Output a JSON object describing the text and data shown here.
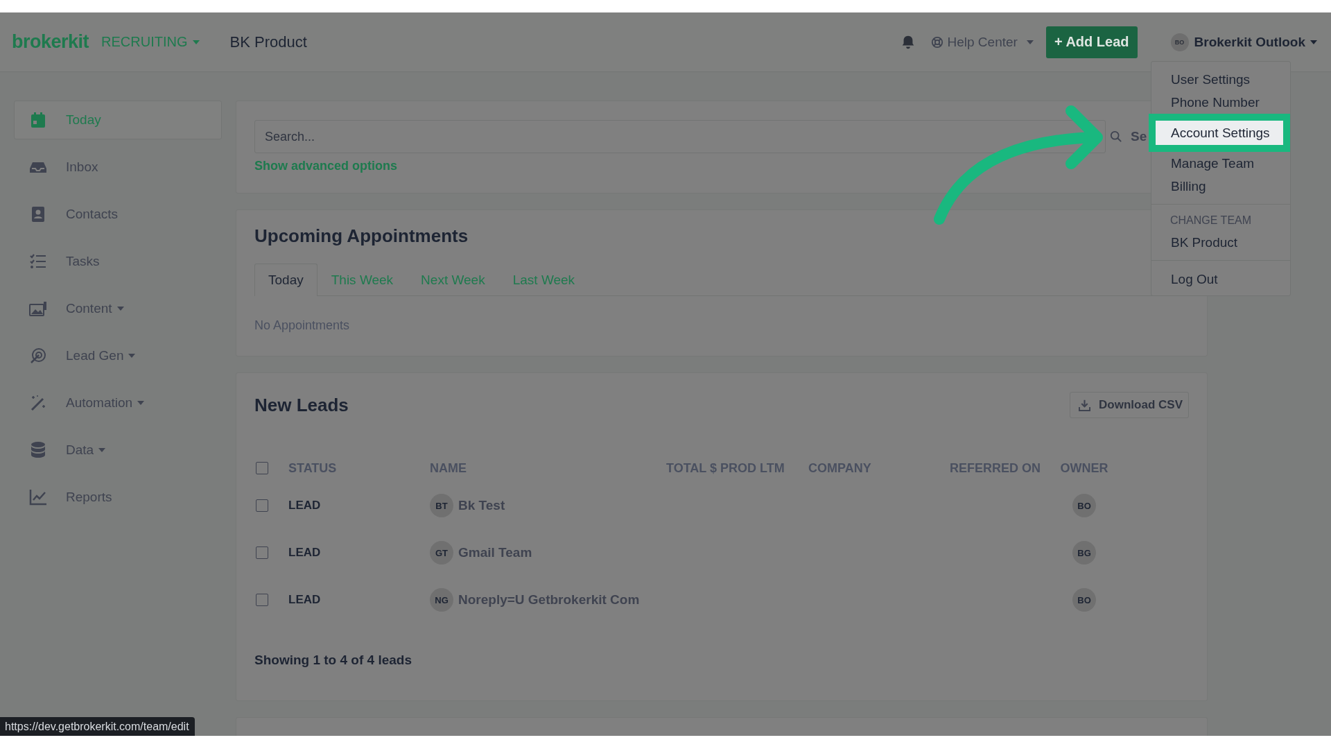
{
  "header": {
    "logo": "brokerkit",
    "module": "RECRUITING",
    "team": "BK Product",
    "help": "Help Center",
    "add_lead": "+ Add Lead",
    "user_initials": "BO",
    "user_name": "Brokerkit Outlook"
  },
  "sidebar": {
    "items": [
      {
        "label": "Today",
        "kind": "calendar",
        "selected": true,
        "dropdown": false
      },
      {
        "label": "Inbox",
        "kind": "inbox",
        "selected": false,
        "dropdown": false
      },
      {
        "label": "Contacts",
        "kind": "contacts",
        "selected": false,
        "dropdown": false
      },
      {
        "label": "Tasks",
        "kind": "tasks",
        "selected": false,
        "dropdown": false
      },
      {
        "label": "Content",
        "kind": "content",
        "selected": false,
        "dropdown": true
      },
      {
        "label": "Lead Gen",
        "kind": "leadgen",
        "selected": false,
        "dropdown": true
      },
      {
        "label": "Automation",
        "kind": "wand",
        "selected": false,
        "dropdown": true
      },
      {
        "label": "Data",
        "kind": "database",
        "selected": false,
        "dropdown": true
      },
      {
        "label": "Reports",
        "kind": "chart",
        "selected": false,
        "dropdown": false
      }
    ]
  },
  "search": {
    "placeholder": "Search...",
    "button": "Se",
    "advanced_link": "Show advanced options"
  },
  "appointments": {
    "title": "Upcoming Appointments",
    "tabs": [
      {
        "label": "Today",
        "selected": true
      },
      {
        "label": "This Week",
        "selected": false
      },
      {
        "label": "Next Week",
        "selected": false
      },
      {
        "label": "Last Week",
        "selected": false
      }
    ],
    "empty": "No Appointments"
  },
  "new_leads": {
    "title": "New Leads",
    "download": "Download CSV",
    "select_all_checked": false,
    "columns": [
      "STATUS",
      "NAME",
      "TOTAL $ PROD LTM",
      "COMPANY",
      "REFERRED ON",
      "OWNER"
    ],
    "rows": [
      {
        "checked": false,
        "status": "LEAD",
        "initials": "BT",
        "name": "Bk Test",
        "owner": "BO"
      },
      {
        "checked": false,
        "status": "LEAD",
        "initials": "GT",
        "name": "Gmail Team",
        "owner": "BG"
      },
      {
        "checked": false,
        "status": "LEAD",
        "initials": "NG",
        "name": "Noreply=U Getbrokerkit Com",
        "owner": "BO"
      }
    ],
    "footer": "Showing 1 to 4 of 4 leads"
  },
  "user_menu": {
    "groups": [
      {
        "items": [
          {
            "label": "User Settings",
            "highlighted": false
          },
          {
            "label": "Phone Number",
            "highlighted": false
          },
          {
            "label": "Account Settings",
            "highlighted": true
          },
          {
            "label": "Manage Team",
            "highlighted": false
          },
          {
            "label": "Billing",
            "highlighted": false
          }
        ]
      },
      {
        "heading": "CHANGE TEAM",
        "items": [
          {
            "label": "BK Product",
            "highlighted": false
          }
        ]
      },
      {
        "items": [
          {
            "label": "Log Out",
            "highlighted": false
          }
        ]
      }
    ]
  },
  "status_url": "https://dev.getbrokerkit.com/team/edit"
}
